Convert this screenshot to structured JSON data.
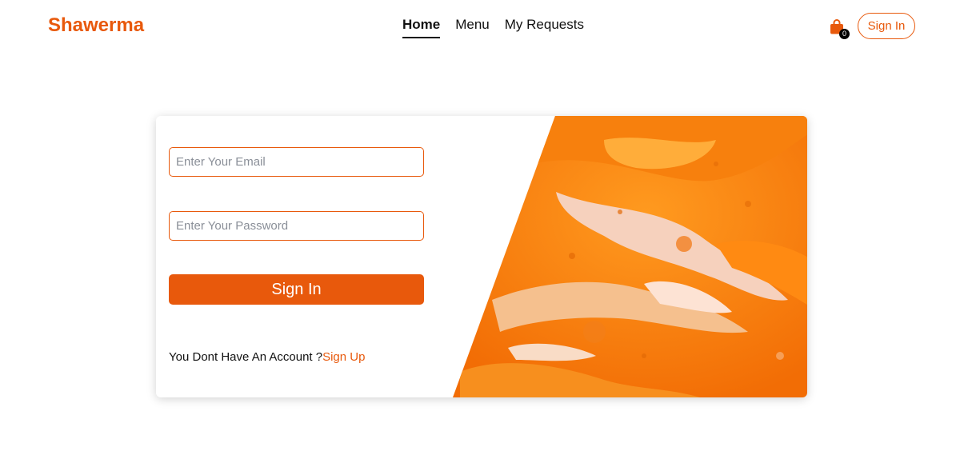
{
  "brand": {
    "name": "Shawerma",
    "color": "#e8590c"
  },
  "nav": {
    "links": [
      {
        "label": "Home",
        "active": true
      },
      {
        "label": "Menu",
        "active": false
      },
      {
        "label": "My Requests",
        "active": false
      }
    ]
  },
  "cart": {
    "icon": "shopping-bag-icon",
    "count": "0"
  },
  "header": {
    "signin_label": "Sign In"
  },
  "login": {
    "email_placeholder": "Enter Your Email",
    "email_value": "",
    "password_placeholder": "Enter Your Password",
    "password_value": "",
    "submit_label": "Sign In",
    "no_account_text": "You Dont Have An Account ?",
    "signup_link": "Sign Up"
  },
  "colors": {
    "accent": "#e8590c",
    "text": "#111111"
  }
}
